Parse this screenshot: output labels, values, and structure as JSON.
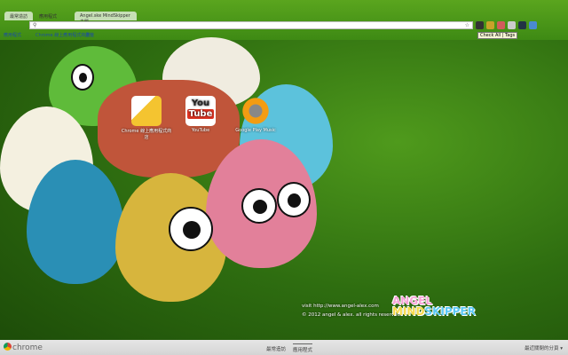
{
  "tabs": [
    {
      "label": "最常造訪"
    },
    {
      "label": "應用程式"
    },
    {
      "label": "Angel.ske MindSkipper 主題"
    }
  ],
  "omnibox": {
    "placeholder": ""
  },
  "tooltip": "Check All | Tags",
  "bookmarks": [
    {
      "label": "應用程式"
    },
    {
      "label": "Chrome 線上應用程式商店"
    },
    {
      "label": "書籤"
    }
  ],
  "apps": [
    {
      "label": "Chrome 線上應用程式商店"
    },
    {
      "label": "YouTube",
      "logo_top": "You",
      "logo_bottom": "Tube"
    },
    {
      "label": "Google Play Music"
    }
  ],
  "credit": {
    "line1": "visit http://www.angel-alex.com",
    "line2": "© 2012 angel & alex. all rights reserved."
  },
  "logo": {
    "line1": "ANGEL",
    "line2a": "MIND",
    "line2b": "SKIPPER"
  },
  "footer": {
    "brand": "chrome",
    "tabs": [
      {
        "label": "最常造訪"
      },
      {
        "label": "應用程式"
      }
    ],
    "recent": "最近關閉的分頁 ▾"
  }
}
